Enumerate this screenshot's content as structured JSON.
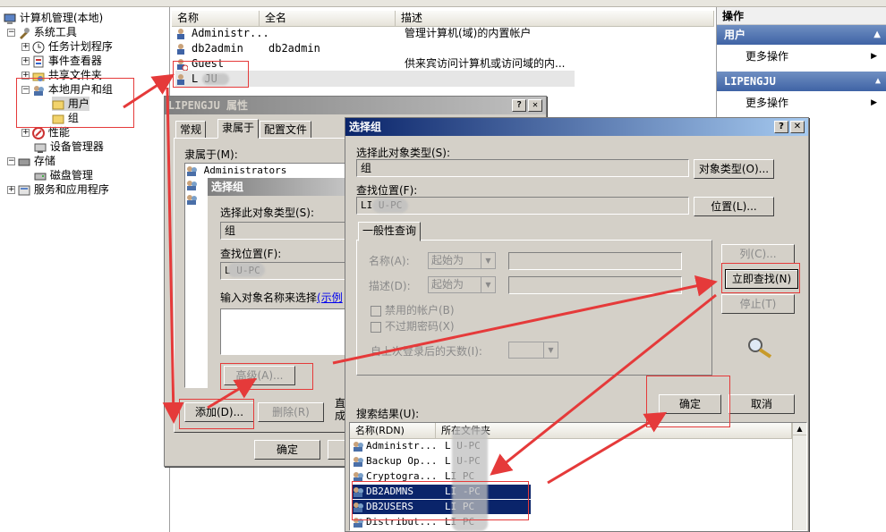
{
  "tree": {
    "root": "计算机管理(本地)",
    "system_tools": "系统工具",
    "task_scheduler": "任务计划程序",
    "event_viewer": "事件查看器",
    "shared_folders": "共享文件夹",
    "local_users_groups": "本地用户和组",
    "users": "用户",
    "groups": "组",
    "performance": "性能",
    "device_manager": "设备管理器",
    "storage": "存储",
    "disk_management": "磁盘管理",
    "services_apps": "服务和应用程序"
  },
  "list": {
    "headers": [
      "名称",
      "全名",
      "描述"
    ],
    "rows": [
      {
        "name": "Administr...",
        "fullname": "",
        "desc": "管理计算机(域)的内置帐户"
      },
      {
        "name": "db2admin",
        "fullname": "db2admin",
        "desc": ""
      },
      {
        "name": "Guest",
        "fullname": "",
        "desc": "供来宾访问计算机或访问域的内..."
      },
      {
        "name": "L     JU",
        "fullname": "",
        "desc": ""
      }
    ]
  },
  "actions": {
    "title": "操作",
    "section1": "用户",
    "more1": "更多操作",
    "section2": "LIPENGJU",
    "more2": "更多操作"
  },
  "props": {
    "title": "LIPENGJU 属性",
    "tabs": [
      "常规",
      "隶属于",
      "配置文件"
    ],
    "member_of_label": "隶属于(M):",
    "members": [
      "Administrators"
    ],
    "add_button": "添加(D)...",
    "remove_button": "删除(R)",
    "ok_button": "确定",
    "partial_note1": "直",
    "partial_note2": "成"
  },
  "select_small": {
    "title": "选择组",
    "object_type_label": "选择此对象类型(S):",
    "object_type_value": "组",
    "location_label": "查找位置(F):",
    "location_value": "L     U-PC",
    "enter_label": "输入对象名称来选择",
    "example_link": "(示例",
    "advanced_button": "高级(A)..."
  },
  "select_adv": {
    "title": "选择组",
    "object_type_label": "选择此对象类型(S):",
    "object_type_value": "组",
    "object_type_button": "对象类型(O)...",
    "location_label": "查找位置(F):",
    "location_value": "LI     U-PC",
    "location_button": "位置(L)...",
    "query_tab": "一般性查询",
    "name_label": "名称(A):",
    "name_mode": "起始为",
    "desc_label": "描述(D):",
    "desc_mode": "起始为",
    "disabled_accounts": "禁用的帐户(B)",
    "no_expire_pw": "不过期密码(X)",
    "days_since_logon": "自上次登录后的天数(I):",
    "columns_button": "列(C)...",
    "find_now_button": "立即查找(N)",
    "stop_button": "停止(T)",
    "ok_button": "确定",
    "cancel_button": "取消",
    "results_label": "搜索结果(U):",
    "results_headers": [
      "名称(RDN)",
      "所在文件夹"
    ],
    "results": [
      {
        "name": "Administr...",
        "folder": "L     U-PC",
        "selected": false
      },
      {
        "name": "Backup Op...",
        "folder": "L     U-PC",
        "selected": false
      },
      {
        "name": "Cryptogra...",
        "folder": "LI     PC",
        "selected": false
      },
      {
        "name": "DB2ADMNS",
        "folder": "LI     -PC",
        "selected": true
      },
      {
        "name": "DB2USERS",
        "folder": "LI     PC",
        "selected": true
      },
      {
        "name": "Distribut...",
        "folder": "LI     PC",
        "selected": false
      }
    ]
  },
  "colors": {
    "highlight_row": "#0a246a",
    "annotation_red": "#e53a3a",
    "dialog_face": "#d4d0c8",
    "action_header": "#3f63a5"
  }
}
